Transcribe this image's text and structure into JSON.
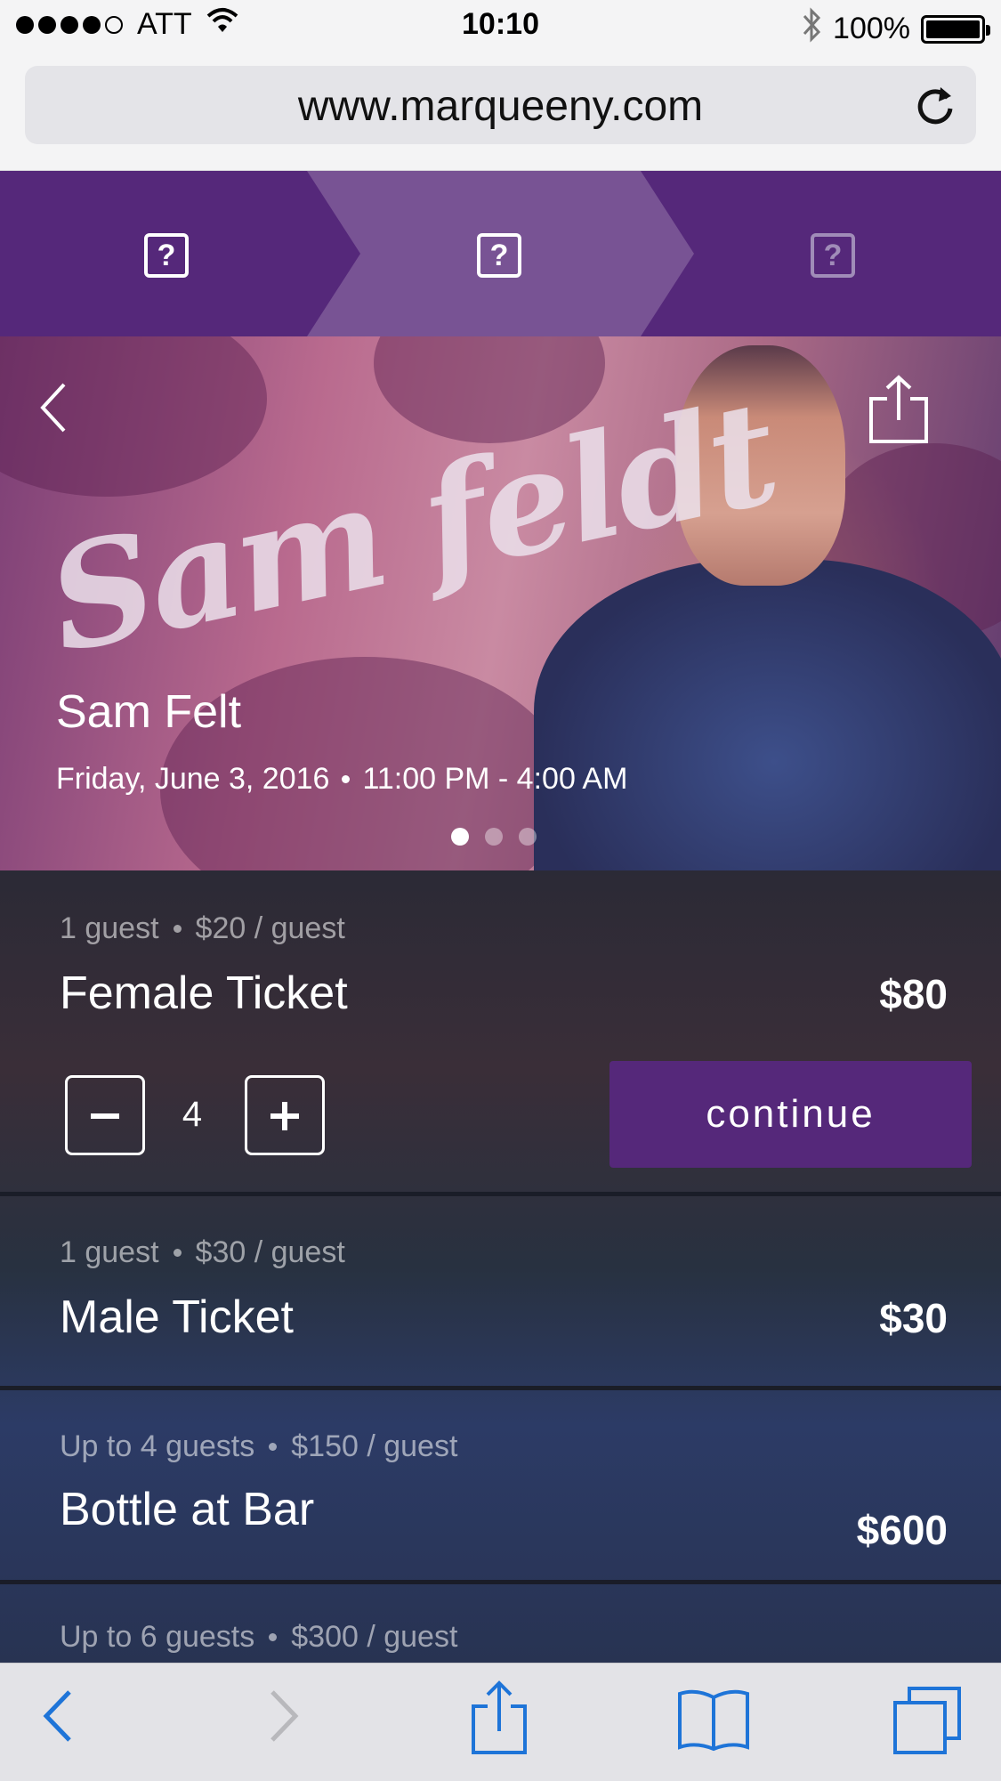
{
  "status_bar": {
    "carrier": "ATT",
    "time": "10:10",
    "battery": "100%",
    "signal_bars_filled": 4,
    "signal_bars_total": 5
  },
  "browser": {
    "url": "www.marqueeny.com"
  },
  "progress_steps": {
    "icons": [
      "?",
      "?",
      "?"
    ],
    "active_step": 2
  },
  "event": {
    "logo_text": "Sam feldt",
    "title": "Sam Felt",
    "date": "Friday, June 3, 2016",
    "time_range": "11:00 PM - 4:00 AM",
    "carousel_pages": 3,
    "carousel_active": 1
  },
  "tickets": [
    {
      "guests": "1 guest",
      "per_guest": "$20 / guest",
      "name": "Female Ticket",
      "price": "$80",
      "quantity": "4",
      "continue_label": "continue"
    },
    {
      "guests": "1 guest",
      "per_guest": "$30 / guest",
      "name": "Male Ticket",
      "price": "$30"
    },
    {
      "guests": "Up to 4 guests",
      "per_guest": "$150 / guest",
      "name": "Bottle at Bar",
      "price": "$600"
    },
    {
      "guests": "Up to 6 guests",
      "per_guest": "$300 / guest"
    }
  ],
  "icons": {
    "wifi": "wifi-icon",
    "bluetooth": "bluetooth-icon",
    "reload": "reload-icon",
    "back": "chevron-left-icon",
    "share": "share-icon",
    "bookmarks": "book-icon",
    "tabs": "tabs-icon"
  },
  "colors": {
    "brand_purple": "#55287a",
    "active_step": "#785394",
    "ios_blue": "#1e74d8"
  }
}
